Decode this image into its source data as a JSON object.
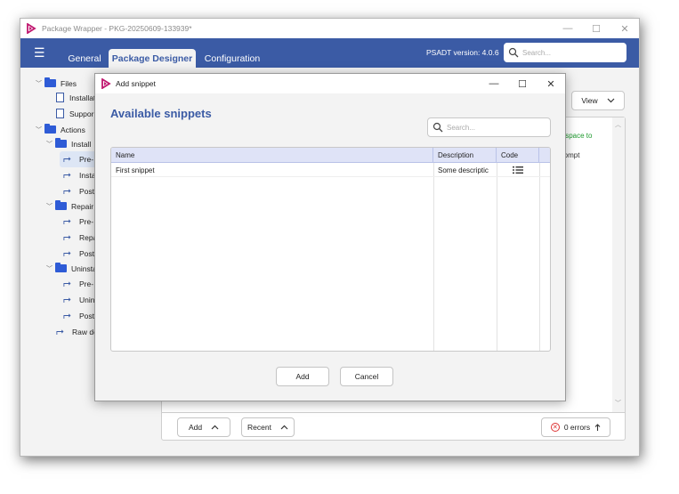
{
  "window": {
    "title": "Package Wrapper - PKG-20250609-133939*",
    "controls": {
      "minimize": "—",
      "maximize": "☐",
      "close": "✕"
    }
  },
  "nav": {
    "menu_glyph": "☰",
    "tabs": [
      {
        "label": "General"
      },
      {
        "label": "Package Designer"
      },
      {
        "label": "Configuration"
      }
    ],
    "version": "PSADT version: 4.0.6",
    "search_placeholder": "Search..."
  },
  "tree": {
    "files": "Files",
    "installation": "Installati",
    "support": "Suppor",
    "actions": "Actions",
    "install": "Install",
    "install_pre": "Pre-",
    "install_install": "Insta",
    "install_post": "Post",
    "repair": "Repair",
    "repair_pre": "Pre-",
    "repair_repair": "Repa",
    "repair_post": "Post",
    "uninstall": "Uninsta",
    "uninstall_pre": "Pre-",
    "uninstall_uninstall": "Unin",
    "uninstall_post": "Post",
    "raw": "Raw de"
  },
  "right_panel": {
    "view_label": "View",
    "hint_green": "k space to",
    "hint_prompt": "rompt"
  },
  "bottom": {
    "add_label": "Add",
    "recent_label": "Recent",
    "errors_label": "0 errors"
  },
  "dialog": {
    "title": "Add snippet",
    "controls": {
      "minimize": "—",
      "maximize": "☐",
      "close": "✕"
    },
    "heading": "Available snippets",
    "search_placeholder": "Search...",
    "columns": {
      "name": "Name",
      "description": "Description",
      "code": "Code"
    },
    "rows": [
      {
        "name": "First snippet",
        "description": "Some descriptic",
        "code_icon": "list-icon"
      }
    ],
    "add_label": "Add",
    "cancel_label": "Cancel"
  },
  "colors": {
    "accent": "#3b5ba5",
    "folder": "#2e5bd6",
    "header_row": "#dfe3f7",
    "success_text": "#1e9a2e",
    "error": "#dd3333"
  }
}
